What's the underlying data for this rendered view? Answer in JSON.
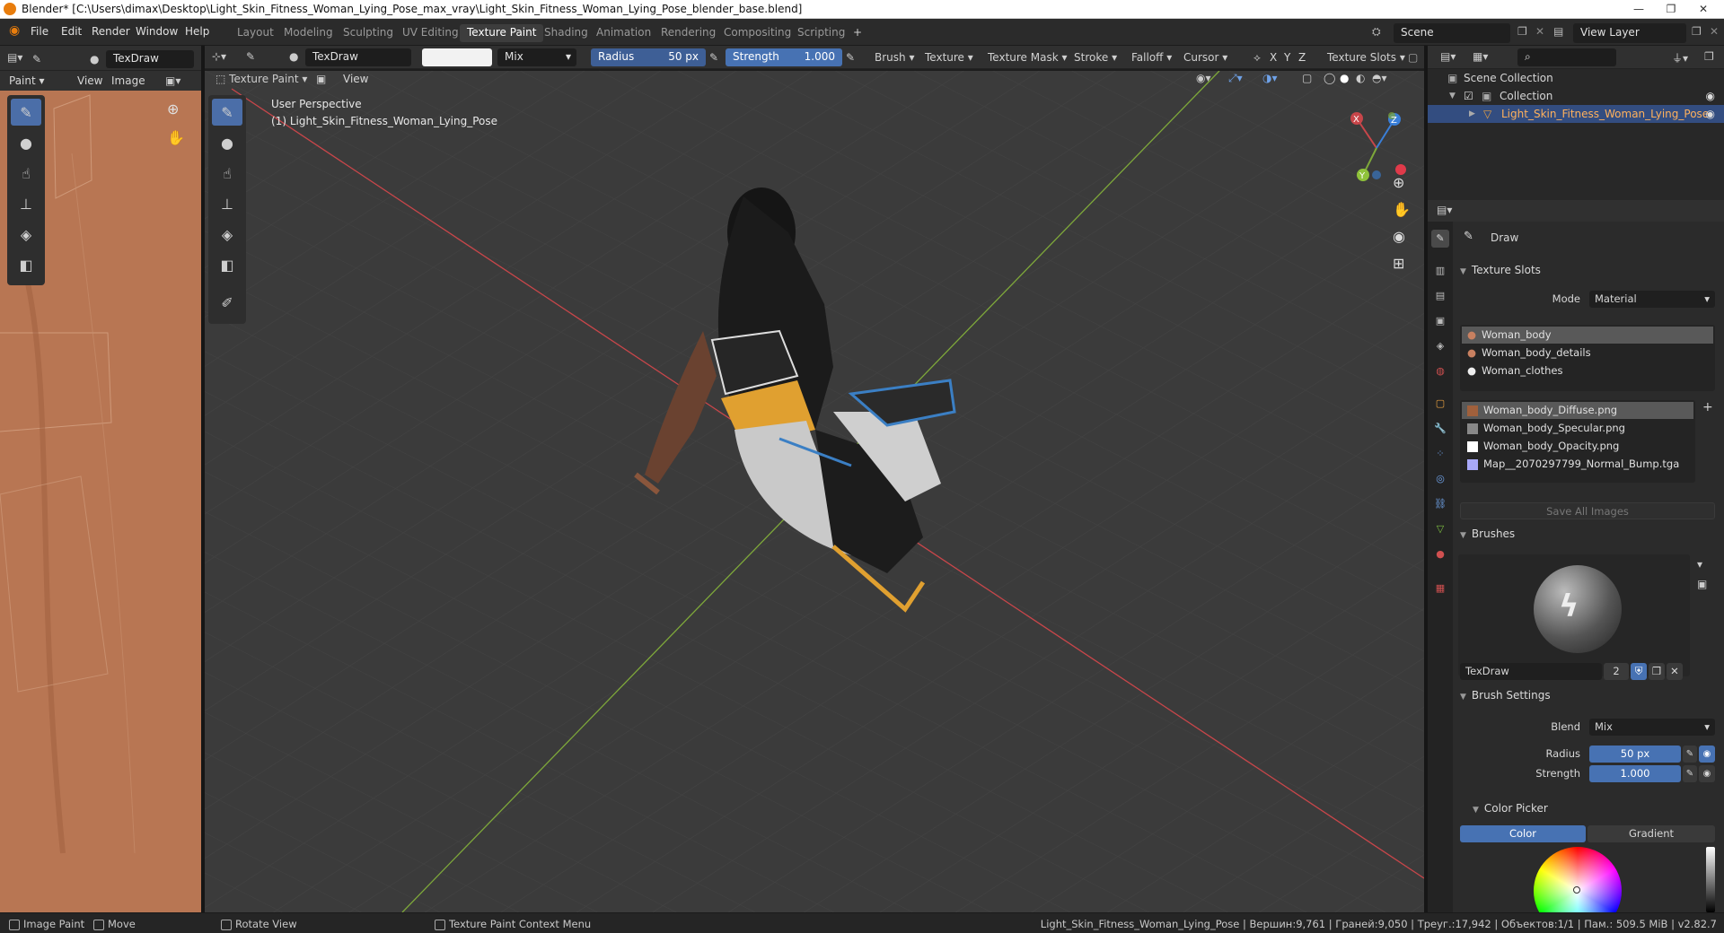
{
  "window": {
    "title": "Blender* [C:\\Users\\dimax\\Desktop\\Light_Skin_Fitness_Woman_Lying_Pose_max_vray\\Light_Skin_Fitness_Woman_Lying_Pose_blender_base.blend]",
    "min_label": "—",
    "max_label": "❐",
    "close_label": "✕"
  },
  "menu": [
    "File",
    "Edit",
    "Render",
    "Window",
    "Help"
  ],
  "workspaces": [
    "Layout",
    "Modeling",
    "Sculpting",
    "UV Editing",
    "Texture Paint",
    "Shading",
    "Animation",
    "Rendering",
    "Compositing",
    "Scripting"
  ],
  "workspace_add": "+",
  "scene": {
    "label": "Scene",
    "view_layer": "View Layer"
  },
  "uv_editor": {
    "mode": "Paint",
    "menus": [
      "View",
      "Image"
    ],
    "brush": "TexDraw"
  },
  "tool_settings": {
    "brush_name": "TexDraw",
    "blend": "Mix",
    "radius_label": "Radius",
    "radius_value": "50 px",
    "strength_label": "Strength",
    "strength_value": "1.000",
    "menus": [
      "Brush",
      "Texture",
      "Texture Mask",
      "Stroke",
      "Falloff",
      "Cursor"
    ],
    "axes": [
      "X",
      "Y",
      "Z"
    ],
    "texture_slots": "Texture Slots"
  },
  "viewport": {
    "mode": "Texture Paint",
    "view_menu": "View",
    "overlay_line1": "User Perspective",
    "overlay_line2": "(1) Light_Skin_Fitness_Woman_Lying_Pose",
    "gizmo": {
      "x": "X",
      "y": "Y",
      "z": "Z"
    }
  },
  "outliner": {
    "root": "Scene Collection",
    "collection": "Collection",
    "object": "Light_Skin_Fitness_Woman_Lying_Pose"
  },
  "properties": {
    "tool_name": "Draw",
    "texture_slots_header": "Texture Slots",
    "mode_label": "Mode",
    "mode_value": "Material",
    "materials": [
      "Woman_body",
      "Woman_body_details",
      "Woman_clothes"
    ],
    "images": [
      "Woman_body_Diffuse.png",
      "Woman_body_Specular.png",
      "Woman_body_Opacity.png",
      "Map__2070297799_Normal_Bump.tga"
    ],
    "save_all": "Save All Images",
    "brushes_header": "Brushes",
    "brush_name": "TexDraw",
    "brush_users": "2",
    "brush_settings_header": "Brush Settings",
    "blend_label": "Blend",
    "blend_value": "Mix",
    "radius_label": "Radius",
    "radius_value": "50 px",
    "strength_label": "Strength",
    "strength_value": "1.000",
    "color_picker_header": "Color Picker",
    "color_tab": "Color",
    "gradient_tab": "Gradient"
  },
  "status": {
    "left1": "Image Paint",
    "left2": "Move",
    "mid1": "Rotate View",
    "mid2": "Texture Paint Context Menu",
    "right": "Light_Skin_Fitness_Woman_Lying_Pose | Вершин:9,761 | Граней:9,050 | Треуг.:17,942 | Объектов:1/1 | Пам.: 509.5 MiB | v2.82.7"
  },
  "colors": {
    "accent": "#4772b3",
    "uv_background": "#b87653",
    "viewport_bg": "#3b3b3b",
    "x_axis": "#c8464a",
    "y_axis": "#7ea83a"
  }
}
